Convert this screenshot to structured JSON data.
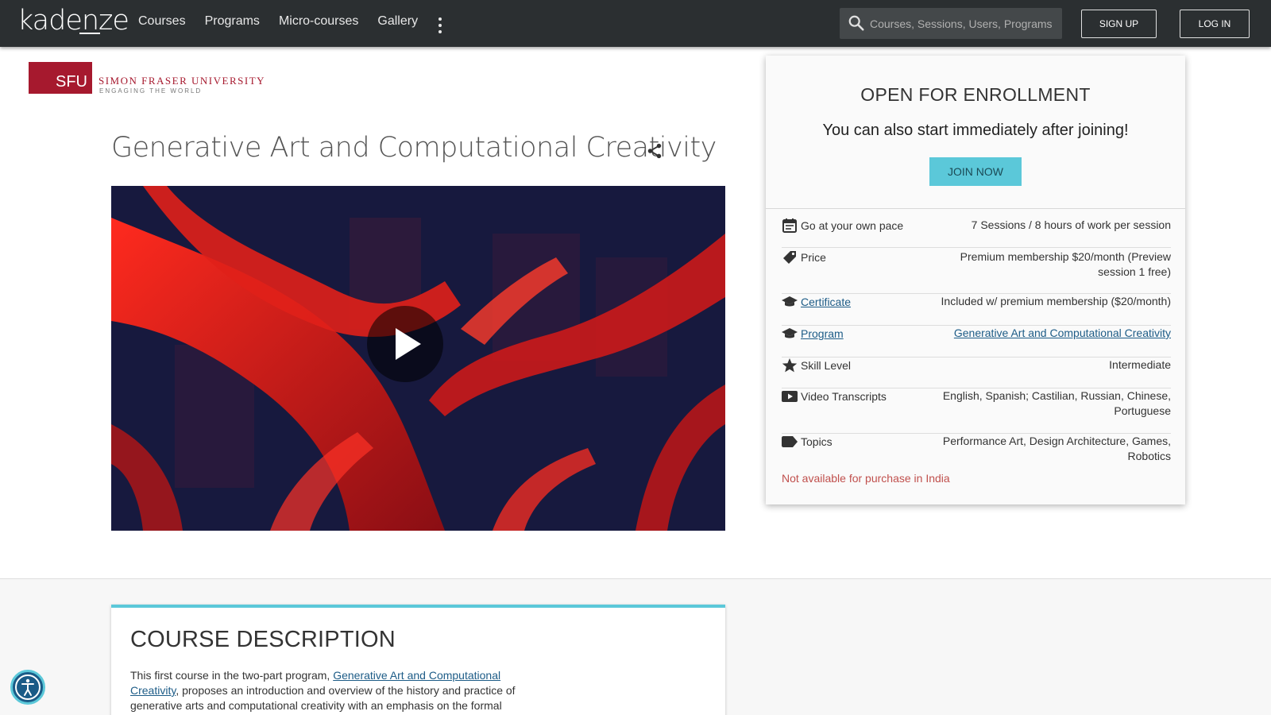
{
  "nav": {
    "logo": "kadenze",
    "links": [
      "Courses",
      "Programs",
      "Micro-courses",
      "Gallery"
    ],
    "search_placeholder": "Courses, Sessions, Users, Programs",
    "signup_label": "SIGN UP",
    "login_label": "LOG IN"
  },
  "institution": {
    "abbr": "SFU",
    "name": "SIMON FRASER UNIVERSITY",
    "tagline": "ENGAGING THE WORLD"
  },
  "course": {
    "title": "Generative Art and Computational Creativity"
  },
  "enrollment": {
    "title": "OPEN FOR ENROLLMENT",
    "subtitle": "You can also start immediately after joining!",
    "join_label": "JOIN NOW",
    "rows": [
      {
        "icon": "calendar-icon",
        "label": "Go at your own pace",
        "value": "7 Sessions / 8 hours of work per session"
      },
      {
        "icon": "price-tag-icon",
        "label": "Price",
        "value": "Premium membership $20/month (Preview session 1 free)"
      },
      {
        "icon": "graduation-cap-icon",
        "label": "Certificate",
        "value": "Included w/ premium membership ($20/month)"
      },
      {
        "icon": "graduation-cap-icon",
        "label": "Program",
        "value": "Generative Art and Computational Creativity"
      },
      {
        "icon": "star-icon",
        "label": "Skill Level",
        "value": "Intermediate"
      },
      {
        "icon": "video-icon",
        "label": "Video Transcripts",
        "value": "English, Spanish; Castilian, Russian, Chinese, Portuguese"
      },
      {
        "icon": "tag-icon",
        "label": "Topics",
        "value": "Performance Art, Design Architecture, Games, Robotics"
      }
    ],
    "unavailable": "Not available for purchase in India"
  },
  "description": {
    "title": "COURSE DESCRIPTION",
    "text_before": "This first course in the two-part program, ",
    "link": "Generative Art and Computational Creativity",
    "text_after": ", proposes an introduction and overview of the history and practice of generative arts and computational creativity with an emphasis on the formal"
  },
  "colors": {
    "nav_bg": "#2b2f31",
    "accent": "#5bc8d9",
    "link": "#1d5c87",
    "sfu_red": "#a6192e",
    "warning": "#c0504d"
  }
}
